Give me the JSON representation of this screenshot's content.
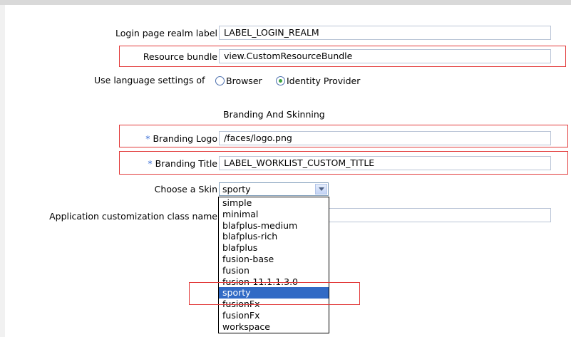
{
  "form": {
    "login_realm": {
      "label": "Login page realm label",
      "value": "LABEL_LOGIN_REALM"
    },
    "resource_bundle": {
      "label": "Resource bundle",
      "value": "view.CustomResourceBundle"
    },
    "language": {
      "label": "Use language settings of",
      "options": [
        "Browser",
        "Identity Provider"
      ],
      "selected": "Identity Provider"
    },
    "section_title": "Branding And Skinning",
    "branding_logo": {
      "required_mark": "*",
      "label": "Branding Logo",
      "value": "/faces/logo.png"
    },
    "branding_title": {
      "required_mark": "*",
      "label": "Branding Title",
      "value": "LABEL_WORKLIST_CUSTOM_TITLE"
    },
    "skin": {
      "label": "Choose a Skin",
      "value": "sporty",
      "options": [
        "simple",
        "minimal",
        "blafplus-medium",
        "blafplus-rich",
        "blafplus",
        "fusion-base",
        "fusion",
        "fusion-11.1.1.3.0",
        "sporty",
        "fusionFx",
        "fusionFx",
        "workspace"
      ],
      "selected_index": 8
    },
    "app_customization": {
      "label": "Application customization class name",
      "value": ""
    }
  },
  "highlight_color": "#e23b3b",
  "selection_color": "#316ac5",
  "required_color": "#3a6fd6"
}
